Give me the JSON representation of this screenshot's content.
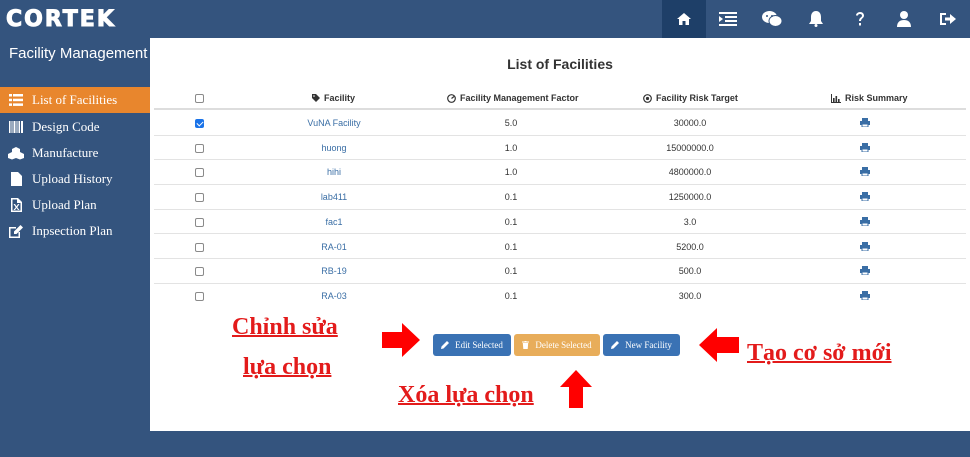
{
  "app": {
    "logo_text": "CORTEK"
  },
  "nav": {
    "icons": [
      "home-icon",
      "list-icon",
      "wechat-icon",
      "bell-icon",
      "question-icon",
      "user-icon",
      "sign-out-icon"
    ]
  },
  "sidebar": {
    "title": "Facility Management",
    "items": [
      {
        "label": "List of Facilities",
        "icon": "list-icon"
      },
      {
        "label": "Design Code",
        "icon": "barcode-icon"
      },
      {
        "label": "Manufacture",
        "icon": "cubes-icon"
      },
      {
        "label": "Upload History",
        "icon": "file-icon"
      },
      {
        "label": "Upload Plan",
        "icon": "file-excel-icon"
      },
      {
        "label": "Inpsection Plan",
        "icon": "edit-icon"
      }
    ]
  },
  "main": {
    "title": "List of Facilities",
    "columns": {
      "facility": "Facility",
      "factor": "Facility Management Factor",
      "target": "Facility Risk Target",
      "summary": "Risk Summary"
    },
    "rows": [
      {
        "checked": true,
        "facility": "VuNA Facility",
        "factor": "5.0",
        "target": "30000.0"
      },
      {
        "checked": false,
        "facility": "huong",
        "factor": "1.0",
        "target": "15000000.0"
      },
      {
        "checked": false,
        "facility": "hihi",
        "factor": "1.0",
        "target": "4800000.0"
      },
      {
        "checked": false,
        "facility": "lab411",
        "factor": "0.1",
        "target": "1250000.0"
      },
      {
        "checked": false,
        "facility": "fac1",
        "factor": "0.1",
        "target": "3.0"
      },
      {
        "checked": false,
        "facility": "RA-01",
        "factor": "0.1",
        "target": "5200.0"
      },
      {
        "checked": false,
        "facility": "RB-19",
        "factor": "0.1",
        "target": "500.0"
      },
      {
        "checked": false,
        "facility": "RA-03",
        "factor": "0.1",
        "target": "300.0"
      }
    ],
    "buttons": {
      "edit": "Edit Selected",
      "delete": "Delete Selected",
      "new": "New Facility"
    }
  },
  "annotations": {
    "edit_line1": "Chỉnh sửa",
    "edit_line2": "lựa chọn",
    "delete": "Xóa lựa chọn",
    "new": "Tạo cơ sở mới"
  },
  "colors": {
    "header": "#34547e",
    "active_nav": "#1e3f68",
    "sidebar_active": "#e8862d",
    "link": "#3a6ea5",
    "button_blue": "#3a72b4",
    "button_orange": "#e8ad5a",
    "annotation": "#e31b1b"
  }
}
